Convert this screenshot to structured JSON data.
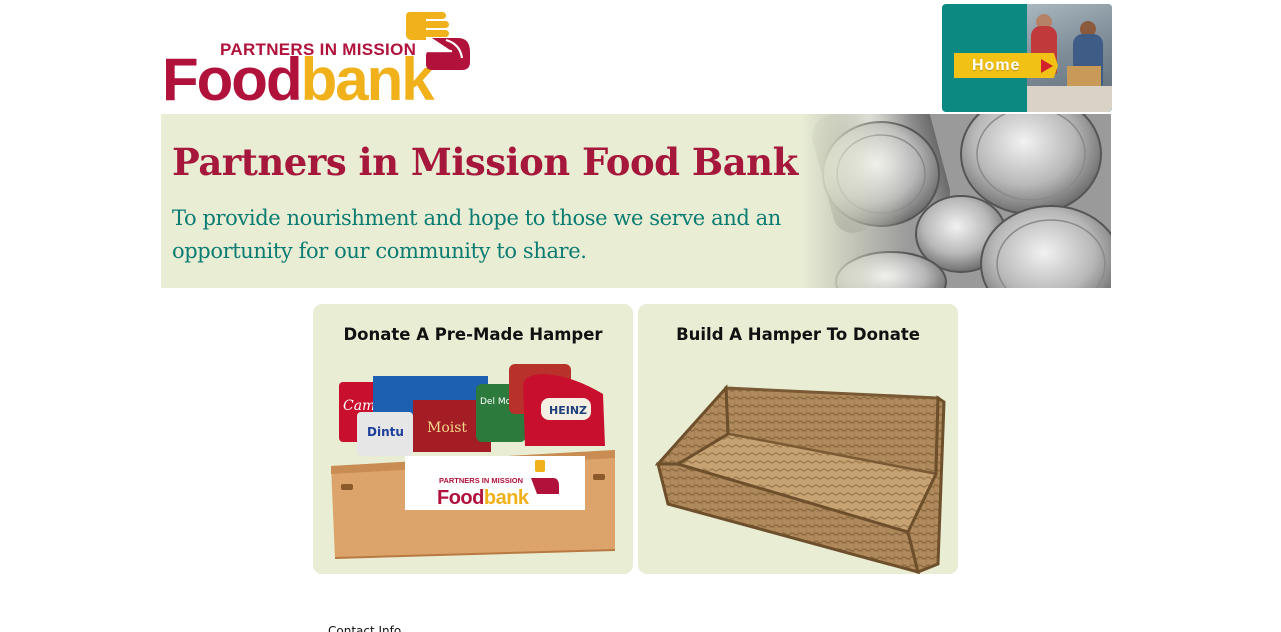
{
  "logo": {
    "subtitle": "PARTNERS IN MISSION",
    "word_food": "Food",
    "word_bank": "bank",
    "colors": {
      "primary": "#b0123b",
      "accent": "#f0b11a"
    }
  },
  "nav": {
    "home_label": "Home",
    "home_icon": "arrow-right-icon"
  },
  "banner": {
    "title": "Partners in Mission Food Bank",
    "tagline": "To provide nourishment and hope to those we serve and an opportunity for our community to share."
  },
  "cards": {
    "pre_made": {
      "title": "Donate A Pre-Made Hamper",
      "crate_label_sub": "PARTNERS IN MISSION",
      "crate_label_food": "Food",
      "crate_label_bank": "bank",
      "can_labels": [
        "Campbell's",
        "Dintu",
        "Moist",
        "Del Monte",
        "HEINZ"
      ]
    },
    "build": {
      "title": "Build A Hamper To Donate"
    }
  },
  "footer": {
    "text": "Contact Info"
  },
  "colors": {
    "banner_bg": "#e8edd4",
    "title_red": "#a5173b",
    "tagline_teal": "#0c7c73",
    "home_teal": "#0c8a82",
    "home_yellow": "#f1c116"
  }
}
